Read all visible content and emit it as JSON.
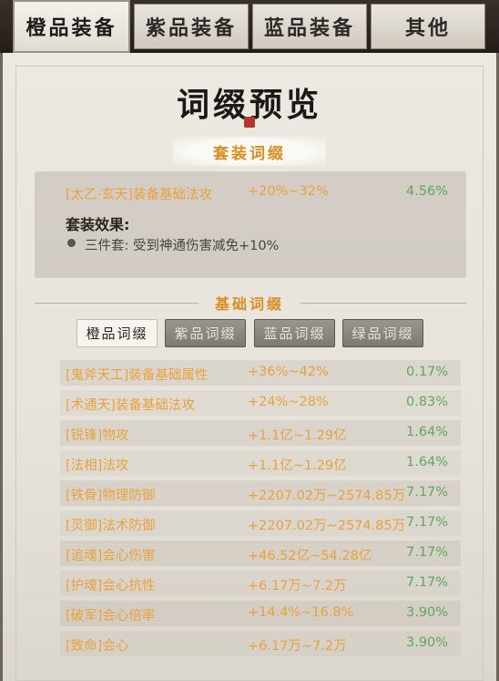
{
  "tabs": [
    {
      "label": "橙品装备",
      "active": true
    },
    {
      "label": "紫品装备",
      "active": false
    },
    {
      "label": "蓝品装备",
      "active": false
    },
    {
      "label": "其他",
      "active": false
    }
  ],
  "title": "词缀预览",
  "set_section": {
    "banner": "套装词缀",
    "affix": {
      "name": "[太乙·玄天]装备基础法攻",
      "range": "+20%~32%",
      "rate": "4.56%"
    },
    "effect_label": "套装效果:",
    "effect_text": "三件套: 受到神通伤害减免+10%"
  },
  "basic_section": {
    "title": "基础词缀",
    "subtabs": [
      {
        "label": "橙品词缀",
        "active": true
      },
      {
        "label": "紫品词缀",
        "active": false
      },
      {
        "label": "蓝品词缀",
        "active": false
      },
      {
        "label": "绿品词缀",
        "active": false
      }
    ],
    "rows": [
      {
        "name": "[鬼斧天工]装备基础属性",
        "range": "+36%~42%",
        "rate": "0.17%"
      },
      {
        "name": "[术通天]装备基础法攻",
        "range": "+24%~28%",
        "rate": "0.83%"
      },
      {
        "name": "[锐锋]物攻",
        "range": "+1.1亿~1.29亿",
        "rate": "1.64%"
      },
      {
        "name": "[法相]法攻",
        "range": "+1.1亿~1.29亿",
        "rate": "1.64%"
      },
      {
        "name": "[铁骨]物理防御",
        "range": "+2207.02万~2574.85万",
        "rate": "7.17%"
      },
      {
        "name": "[灵御]法术防御",
        "range": "+2207.02万~2574.85万",
        "rate": "7.17%"
      },
      {
        "name": "[追魂]会心伤害",
        "range": "+46.52亿~54.28亿",
        "rate": "7.17%"
      },
      {
        "name": "[护魂]会心抗性",
        "range": "+6.17万~7.2万",
        "rate": "7.17%"
      },
      {
        "name": "[破军]会心倍率",
        "range": "+14.4%~16.8%",
        "rate": "3.90%"
      },
      {
        "name": "[致命]会心",
        "range": "+6.17万~7.2万",
        "rate": "3.90%"
      }
    ]
  },
  "colors": {
    "affix_orange": "#e9a23a",
    "rate_green": "#5ea85a",
    "seal_red": "#b3362c"
  }
}
